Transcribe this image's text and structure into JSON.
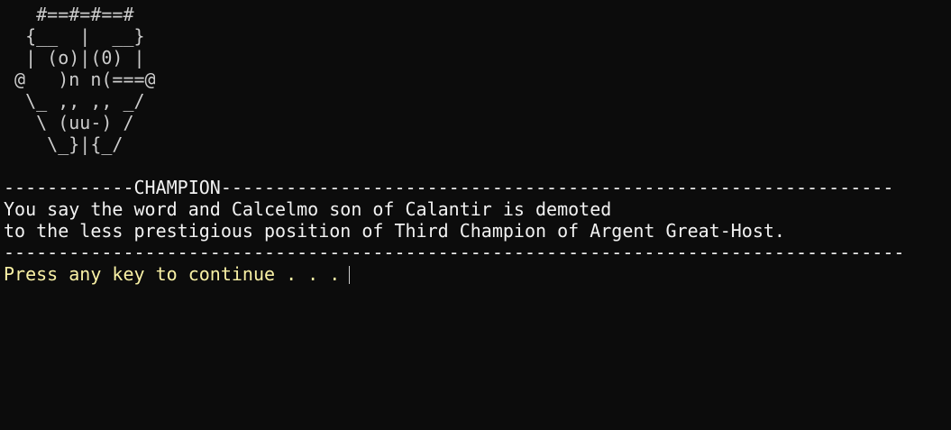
{
  "art_lines": [
    "   #==#=#==#",
    "  {__  |  __}",
    "  | (o)|(0) |",
    " @   )n n(===@",
    "  \\_ ,, ,, _/",
    "   \\ (uu-) /",
    "    \\_}|{_/"
  ],
  "blank_line": "",
  "header_rule": "------------CHAMPION--------------------------------------------------------------",
  "message_lines": [
    "You say the word and Calcelmo son of Calantir is demoted",
    "to the less prestigious position of Third Champion of Argent Great-Host."
  ],
  "footer_rule": "-----------------------------------------------------------------------------------",
  "prompt": "Press any key to continue . . ."
}
